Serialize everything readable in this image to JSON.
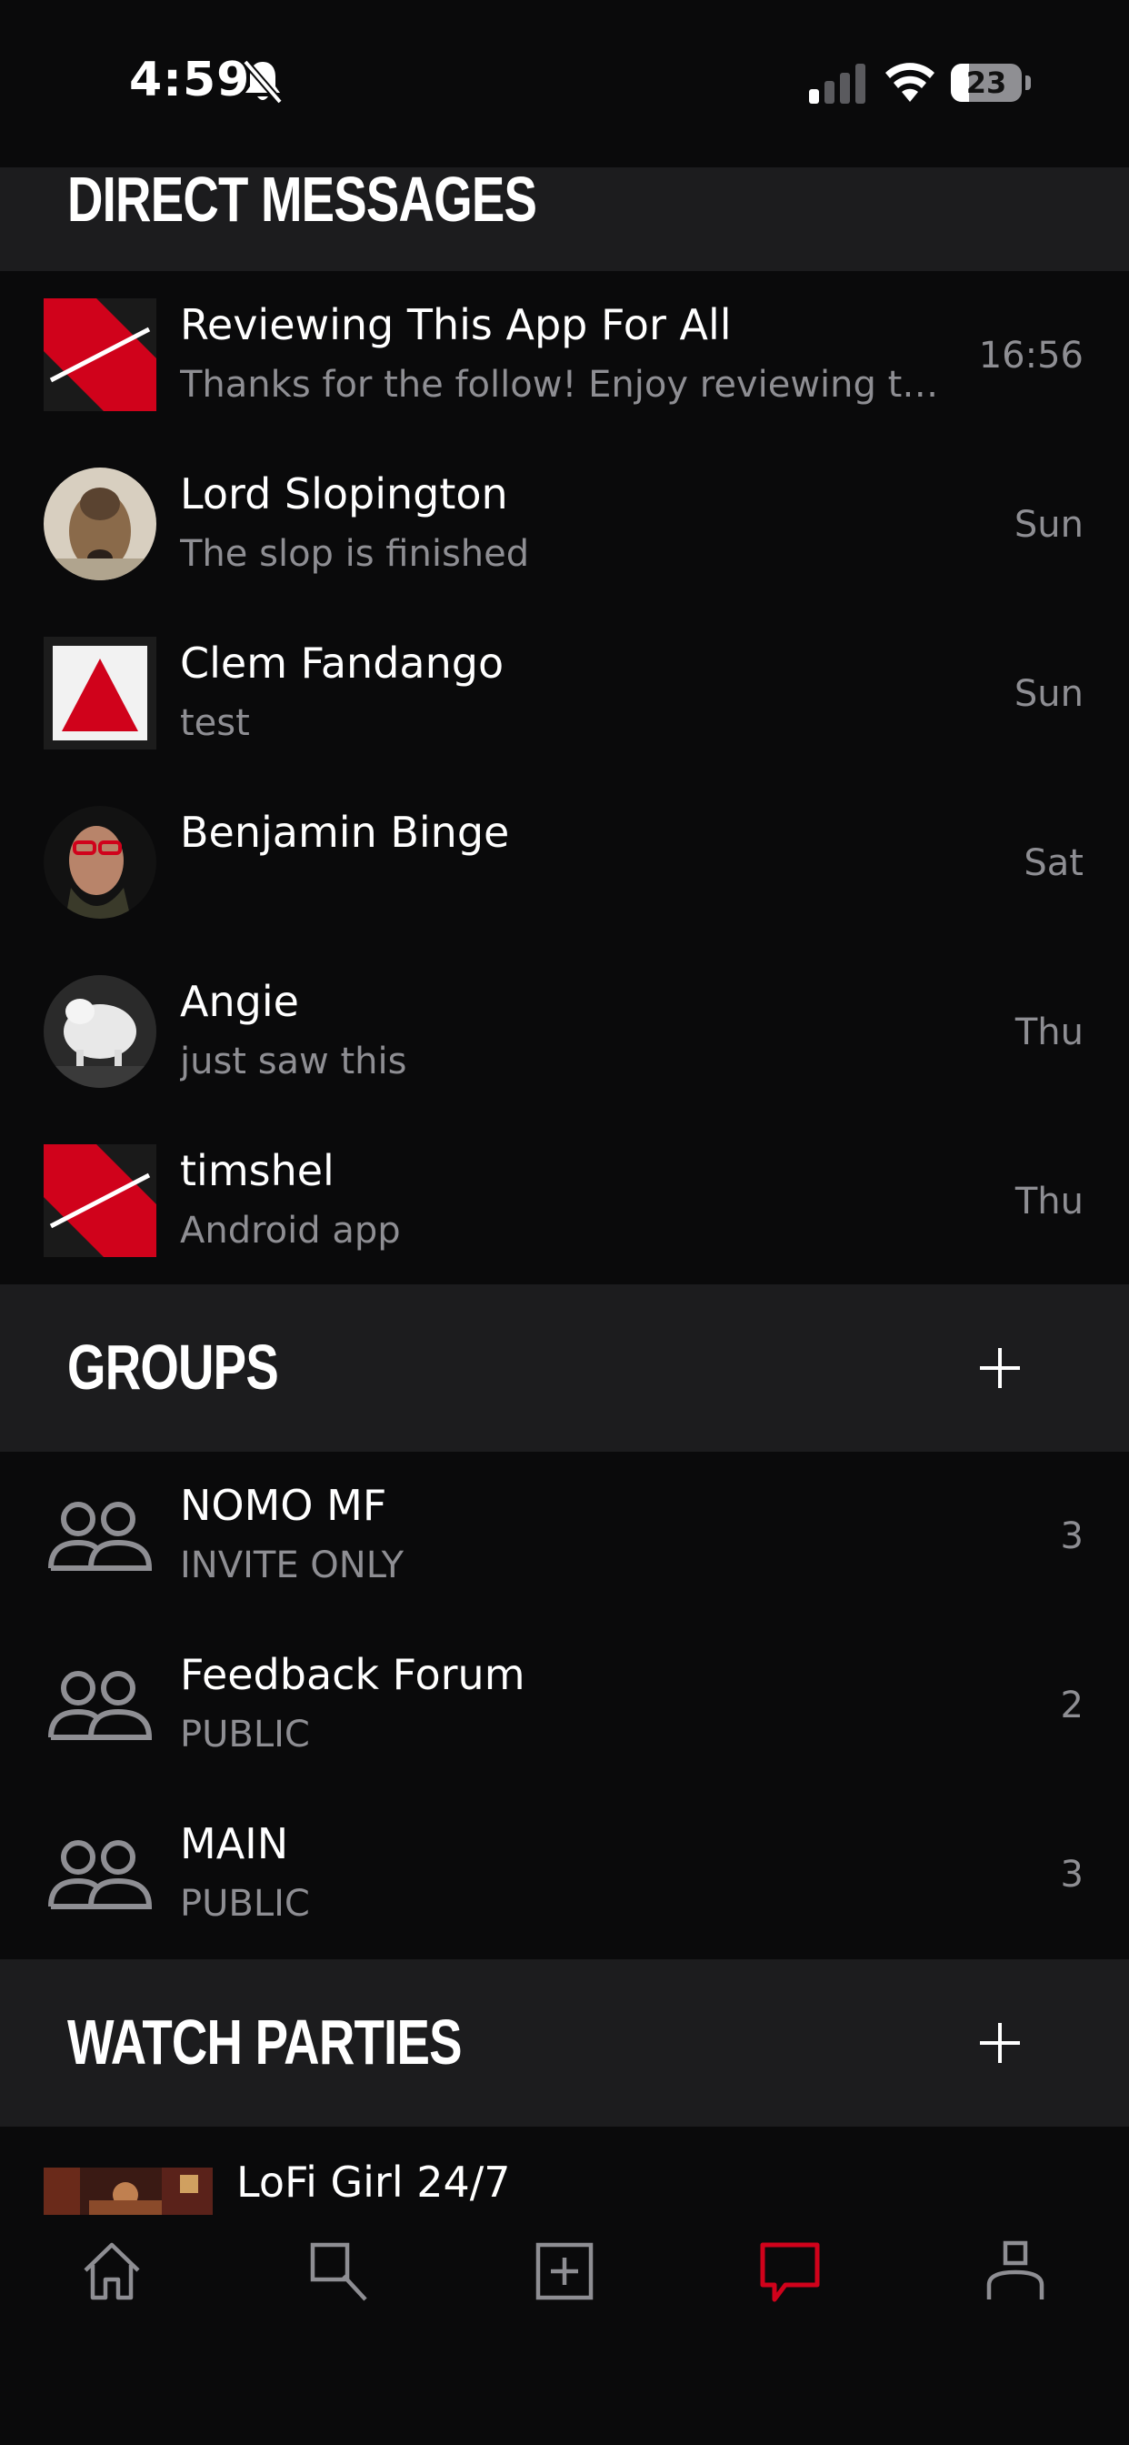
{
  "status_bar": {
    "time": "4:59",
    "battery": "23"
  },
  "direct_messages": {
    "title": "DIRECT MESSAGES",
    "items": [
      {
        "name": "Reviewing This App For All",
        "preview": "Thanks for the follow! Enjoy reviewing th...",
        "time": "16:56",
        "avatar": "red-slash-logo"
      },
      {
        "name": "Lord Slopington",
        "preview": "The slop is finished",
        "time": "Sun",
        "avatar": "dog-photo"
      },
      {
        "name": "Clem Fandango",
        "preview": "test",
        "time": "Sun",
        "avatar": "red-triangle"
      },
      {
        "name": "Benjamin Binge",
        "preview": "",
        "time": "Sat",
        "avatar": "man-photo"
      },
      {
        "name": "Angie",
        "preview": "just saw this",
        "time": "Thu",
        "avatar": "white-animal-photo"
      },
      {
        "name": "timshel",
        "preview": "Android app",
        "time": "Thu",
        "avatar": "red-slash-logo"
      }
    ]
  },
  "groups": {
    "title": "GROUPS",
    "items": [
      {
        "name": "NOMO MF",
        "access": "INVITE ONLY",
        "count": "3"
      },
      {
        "name": "Feedback Forum",
        "access": "PUBLIC",
        "count": "2"
      },
      {
        "name": "MAIN",
        "access": "PUBLIC",
        "count": "3"
      }
    ]
  },
  "watch_parties": {
    "title": "WATCH PARTIES",
    "items": [
      {
        "name": "LoFi Girl 24/7"
      }
    ]
  },
  "tab_bar": {
    "tabs": [
      {
        "icon": "home-icon"
      },
      {
        "icon": "search-icon"
      },
      {
        "icon": "add-icon"
      },
      {
        "icon": "chat-icon",
        "active": true
      },
      {
        "icon": "profile-icon"
      }
    ]
  },
  "colors": {
    "accent": "#d0021b",
    "background": "#0a0a0b",
    "section": "#1c1c1e",
    "muted": "#8e8e93"
  }
}
